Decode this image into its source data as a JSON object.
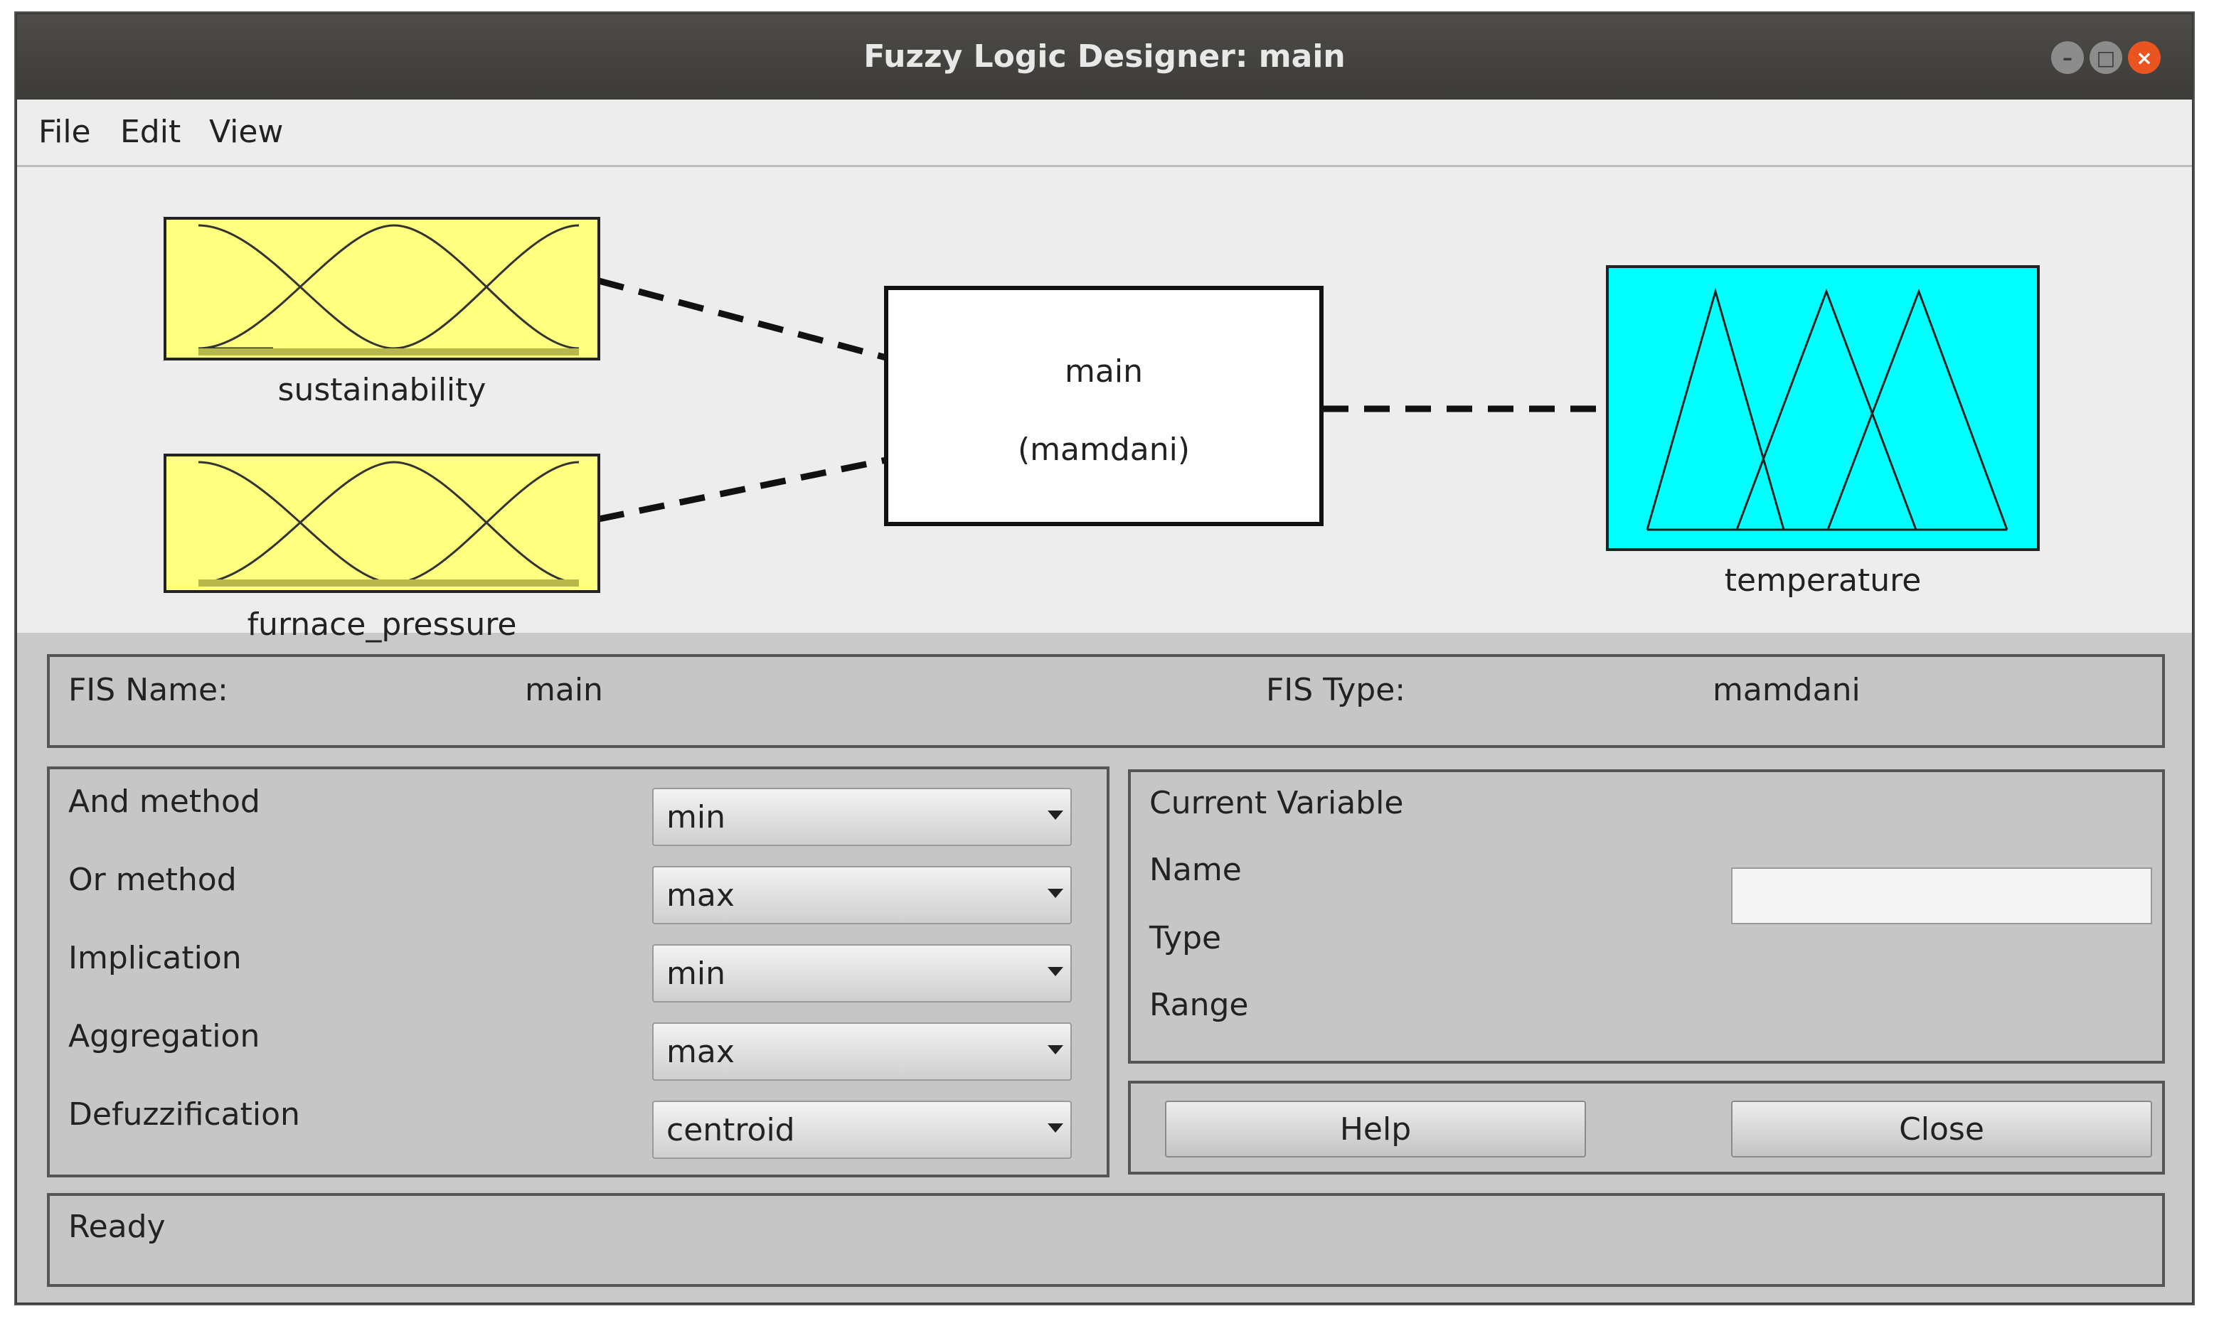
{
  "window": {
    "title": "Fuzzy Logic Designer: main",
    "controls": [
      "minimize-icon",
      "maximize-icon",
      "close-icon"
    ]
  },
  "menu": {
    "file": "File",
    "edit": "Edit",
    "view": "View"
  },
  "diagram": {
    "inputs": [
      {
        "name": "sustainability",
        "color": "#ffff80",
        "mf_shape": "gaussian"
      },
      {
        "name": "furnace_pressure",
        "color": "#ffff80",
        "mf_shape": "gaussian"
      }
    ],
    "system": {
      "name": "main",
      "type": "(mamdani)"
    },
    "output": {
      "name": "temperature",
      "color": "#00ffff",
      "mf_shape": "triangular"
    }
  },
  "fis": {
    "name_label": "FIS Name:",
    "name_value": "main",
    "type_label": "FIS Type:",
    "type_value": "mamdani"
  },
  "methods": {
    "and_label": "And method",
    "and_value": "min",
    "or_label": "Or method",
    "or_value": "max",
    "implication_label": "Implication",
    "implication_value": "min",
    "aggregation_label": "Aggregation",
    "aggregation_value": "max",
    "defuzz_label": "Defuzzification",
    "defuzz_value": "centroid"
  },
  "current_variable": {
    "title": "Current Variable",
    "name_label": "Name",
    "name_value": "",
    "type_label": "Type",
    "range_label": "Range"
  },
  "buttons": {
    "help": "Help",
    "close": "Close"
  },
  "status": "Ready"
}
